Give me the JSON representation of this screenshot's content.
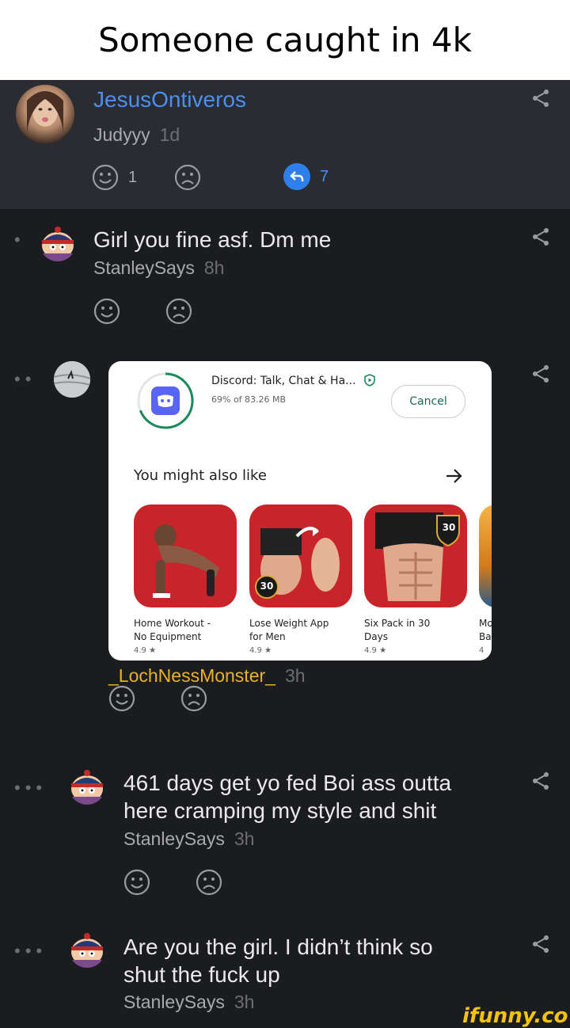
{
  "caption": "Someone caught in 4k",
  "op": {
    "username": "JesusOntiveros",
    "subuser": "Judyyy",
    "time": "1d",
    "smile_count": "1",
    "reply_count": "7"
  },
  "comments": [
    {
      "text": "Girl you fine asf. Dm me",
      "user": "StanleySays",
      "time": "8h"
    },
    {
      "user": "_LochNessMonster_",
      "time": "3h"
    },
    {
      "text_line1": "461 days get yo fed Boi ass outta",
      "text_line2": "here cramping my style and shit",
      "user": "StanleySays",
      "time": "3h"
    },
    {
      "text_line1": "Are you the girl. I didn’t think so",
      "text_line2": "shut the fuck up",
      "user": "StanleySays",
      "time": "3h"
    }
  ],
  "card": {
    "app_title": "Discord: Talk, Chat & Ha...",
    "progress_text": "69% of 83.26 MB",
    "progress": 0.69,
    "cancel": "Cancel",
    "section": "You might also like",
    "apps": [
      {
        "line1": "Home Workout -",
        "line2": "No Equipment",
        "rating": "4.9 ★"
      },
      {
        "line1": "Lose Weight App",
        "line2": "for Men",
        "rating": "4.9 ★",
        "badge": "30"
      },
      {
        "line1": "Six Pack in 30",
        "line2": "Days",
        "rating": "4.9 ★",
        "badge": "30"
      },
      {
        "line1": "Mo",
        "line2": "Ba",
        "rating": "4"
      }
    ]
  },
  "watermark": "ifunny.co"
}
